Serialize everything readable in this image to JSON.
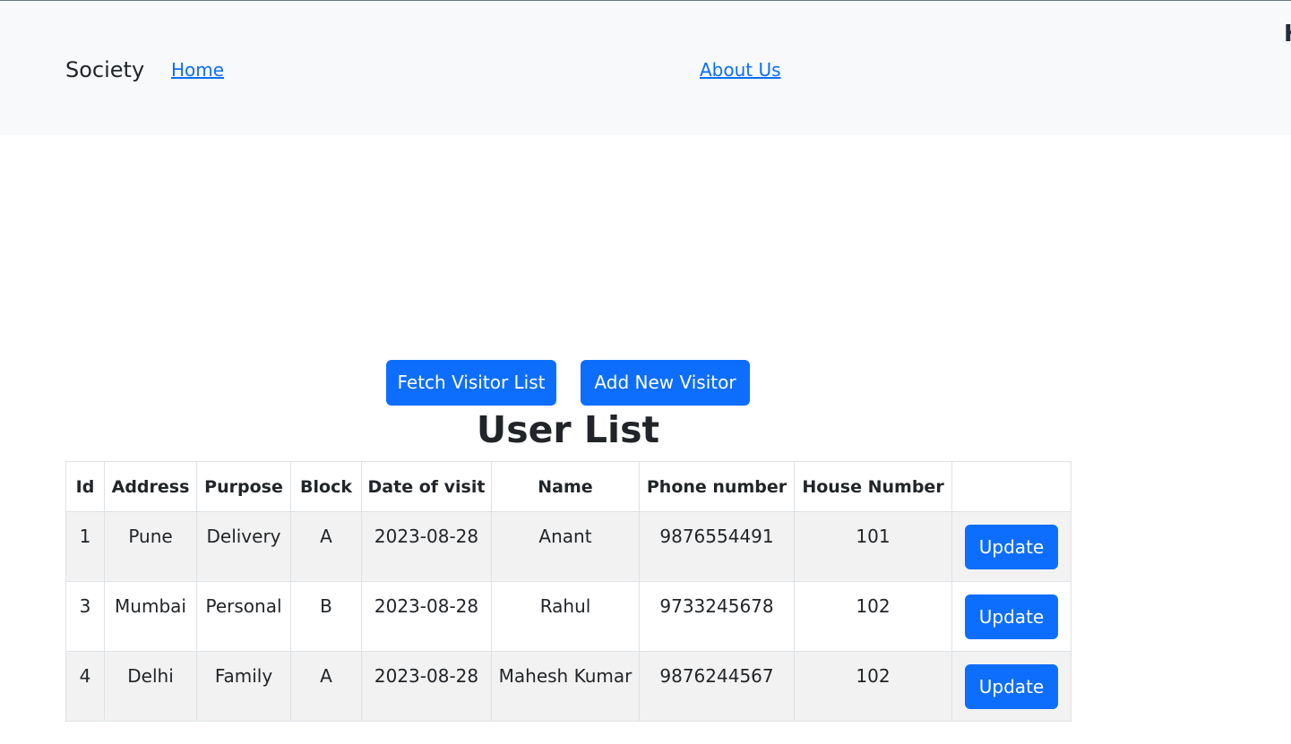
{
  "nav": {
    "brand": "Society",
    "links": [
      {
        "label": "Home"
      },
      {
        "label": "About Us"
      }
    ],
    "cut_text": "H"
  },
  "actions": {
    "fetch_label": "Fetch Visitor List",
    "add_label": "Add New Visitor"
  },
  "main": {
    "title": "User List"
  },
  "table": {
    "columns": [
      "Id",
      "Address",
      "Purpose",
      "Block",
      "Date of visit",
      "Name",
      "Phone number",
      "House Number",
      ""
    ],
    "rows": [
      {
        "id": "1",
        "address": "Pune",
        "purpose": "Delivery",
        "block": "A",
        "date": "2023-08-28",
        "name": "Anant",
        "phone": "9876554491",
        "house": "101",
        "action": "Update"
      },
      {
        "id": "3",
        "address": "Mumbai",
        "purpose": "Personal",
        "block": "B",
        "date": "2023-08-28",
        "name": "Rahul",
        "phone": "9733245678",
        "house": "102",
        "action": "Update"
      },
      {
        "id": "4",
        "address": "Delhi",
        "purpose": "Family",
        "block": "A",
        "date": "2023-08-28",
        "name": "Mahesh Kumar",
        "phone": "9876244567",
        "house": "102",
        "action": "Update"
      }
    ]
  },
  "colors": {
    "primary": "#0d6efd",
    "navbar_bg": "#f8f9fa",
    "stripe_bg": "#f2f2f2",
    "border": "#dee2e6",
    "text": "#212529"
  }
}
